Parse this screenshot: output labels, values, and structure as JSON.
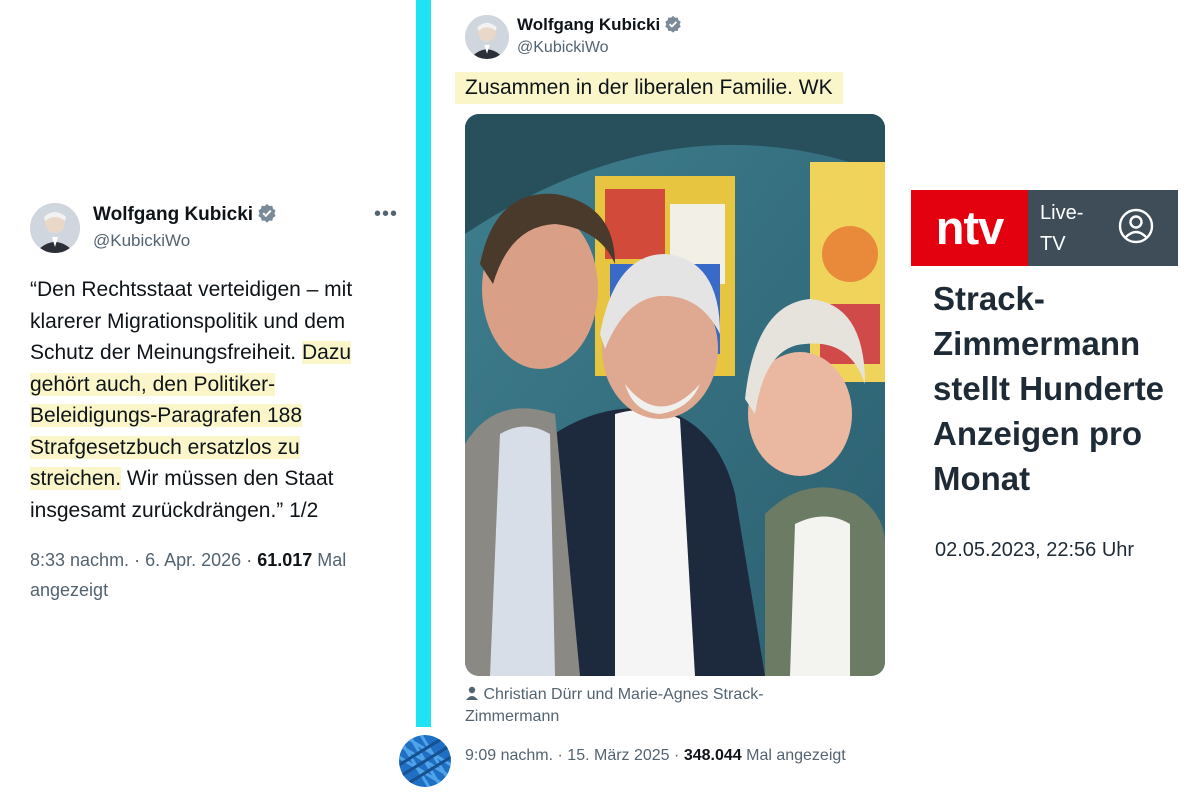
{
  "left_tweet": {
    "author_name": "Wolfgang Kubicki",
    "author_handle": "@KubickiWo",
    "more_label": "•••",
    "text_lines": [
      [
        {
          "t": "“Den Rechtsstaat verteidigen – mit",
          "hl": false
        }
      ],
      [
        {
          "t": "klarerer Migrationspolitik und dem",
          "hl": false
        }
      ],
      [
        {
          "t": "Schutz der Meinungsfreiheit. ",
          "hl": false
        },
        {
          "t": "Dazu",
          "hl": true
        }
      ],
      [
        {
          "t": "gehört auch, den Politiker-",
          "hl": true
        }
      ],
      [
        {
          "t": "Beleidigungs-Paragrafen 188",
          "hl": true
        }
      ],
      [
        {
          "t": "Strafgesetzbuch ersatzlos zu",
          "hl": true
        }
      ],
      [
        {
          "t": "streichen.",
          "hl": true
        },
        {
          "t": " Wir müssen den Staat",
          "hl": false
        }
      ],
      [
        {
          "t": "insgesamt zurückdrängen.” 1/2",
          "hl": false
        }
      ]
    ],
    "time": "8:33 nachm.",
    "date": "6. Apr. 2026",
    "views": "61.017",
    "views_label": "Mal",
    "views_label_2": "angezeigt"
  },
  "middle_tweet": {
    "author_name": "Wolfgang Kubicki",
    "author_handle": "@KubickiWo",
    "text": "Zusammen in der liberalen Familie. WK",
    "caption_line1": "Christian Dürr und Marie-Agnes Strack-",
    "caption_line2": "Zimmermann",
    "time": "9:09 nachm.",
    "date": "15. März 2025",
    "views": "348.044",
    "views_label": "Mal angezeigt"
  },
  "ntv": {
    "logo": "ntv",
    "live_line1": "Live-",
    "live_line2": "TV",
    "headline_lines": [
      "Strack-",
      "Zimmermann",
      "stellt Hunderte",
      "Anzeigen pro",
      "Monat"
    ],
    "datetime": "02.05.2023, 22:56 Uhr"
  },
  "colors": {
    "highlight": "#fbf6c9",
    "cyan_bar": "#1fe3f2",
    "ntv_red": "#e3000f",
    "ntv_dark": "#3f4d59",
    "verified_blue": "#7b8a99"
  },
  "icons": [
    "verified-badge-icon",
    "more-icon",
    "person-icon",
    "account-icon"
  ]
}
